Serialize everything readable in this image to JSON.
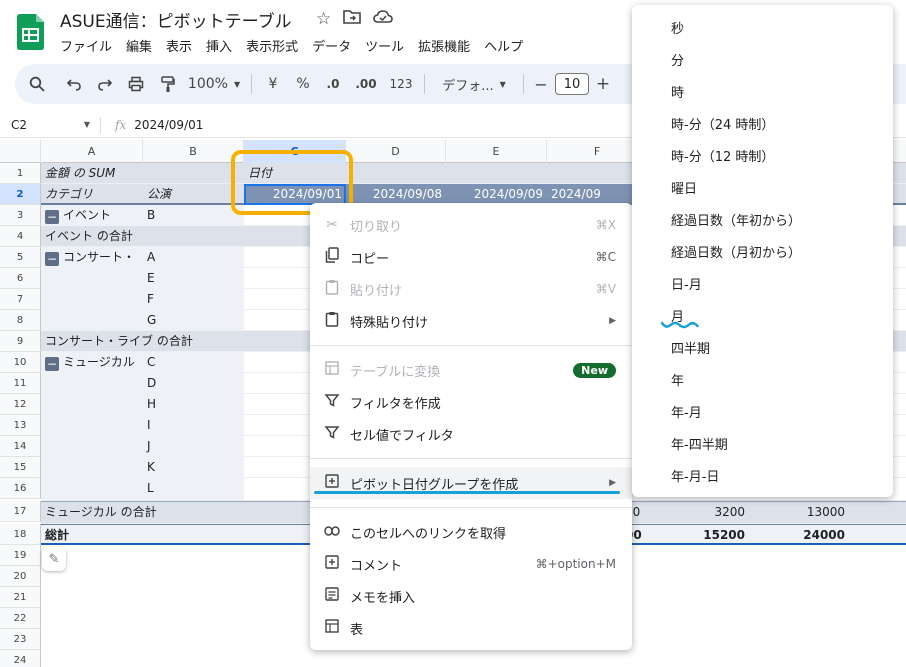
{
  "app": {
    "title": "ASUE通信：ピボットテーブル",
    "menus": [
      "ファイル",
      "編集",
      "表示",
      "挿入",
      "表示形式",
      "データ",
      "ツール",
      "拡張機能",
      "ヘルプ"
    ]
  },
  "toolbar": {
    "zoom": "100%",
    "currency": "¥",
    "percent": "%",
    "dec_decrease": ".0",
    "dec_increase": ".00",
    "number_format": "123",
    "font": "デフォ...",
    "font_size": "10",
    "minus": "−",
    "plus": "+"
  },
  "formula": {
    "cell_ref": "C2",
    "fx": "fx",
    "value": "2024/09/01"
  },
  "columns": [
    "A",
    "B",
    "C",
    "D",
    "E",
    "F"
  ],
  "rows": [
    "1",
    "2",
    "3",
    "4",
    "5",
    "6",
    "7",
    "8",
    "9",
    "10",
    "11",
    "12",
    "13",
    "14",
    "15",
    "16",
    "17",
    "18",
    "19",
    "20",
    "21",
    "22",
    "23",
    "24"
  ],
  "pivot": {
    "r1_a": "金額 の SUM",
    "r1_c": "日付",
    "r2_a": "カテゴリ",
    "r2_b": "公演",
    "dates": [
      "2024/09/01",
      "2024/09/08",
      "2024/09/09",
      "2024/09"
    ],
    "r3_a": "イベント",
    "r3_b": "B",
    "r4_a": "イベント の合計",
    "r5_a": "コンサート・",
    "r5_b": "A",
    "r6_b": "E",
    "r7_b": "F",
    "r8_b": "G",
    "r9_a": "コンサート・ライブ の合計",
    "r10_a": "ミュージカル",
    "r10_b": "C",
    "r11_b": "D",
    "r12_b": "H",
    "r13_b": "I",
    "r14_b": "J",
    "r15_b": "K",
    "r16_b": "L",
    "r17_a": "ミュージカル の合計",
    "r17_vals": [
      "00",
      "3200",
      "13000"
    ],
    "r18_a": "総計",
    "r18_vals": [
      "00",
      "15200",
      "24000"
    ]
  },
  "context_menu": {
    "cut": {
      "label": "切り取り",
      "shortcut": "⌘X"
    },
    "copy": {
      "label": "コピー",
      "shortcut": "⌘C"
    },
    "paste": {
      "label": "貼り付け",
      "shortcut": "⌘V"
    },
    "paste_special": {
      "label": "特殊貼り付け"
    },
    "convert_table": {
      "label": "テーブルに変換",
      "badge": "New"
    },
    "create_filter": {
      "label": "フィルタを作成"
    },
    "filter_by_value": {
      "label": "セル値でフィルタ"
    },
    "pivot_date_group": {
      "label": "ピボット日付グループを作成"
    },
    "get_link": {
      "label": "このセルへのリンクを取得"
    },
    "comment": {
      "label": "コメント",
      "shortcut": "⌘+option+M"
    },
    "insert_note": {
      "label": "メモを挿入"
    },
    "table": {
      "label": "表"
    }
  },
  "submenu": [
    "秒",
    "分",
    "時",
    "時-分（24 時制）",
    "時-分（12 時制）",
    "曜日",
    "経過日数（年初から）",
    "経過日数（月初から）",
    "日-月",
    "月",
    "四半期",
    "年",
    "年-月",
    "年-四半期",
    "年-月-日"
  ],
  "colors": {
    "accent": "#1a73e8",
    "highlight_orange": "#f6b100",
    "underline_blue": "#1aa0d8",
    "pivot_header": "#7e93b4",
    "new_badge": "#146c2e"
  }
}
